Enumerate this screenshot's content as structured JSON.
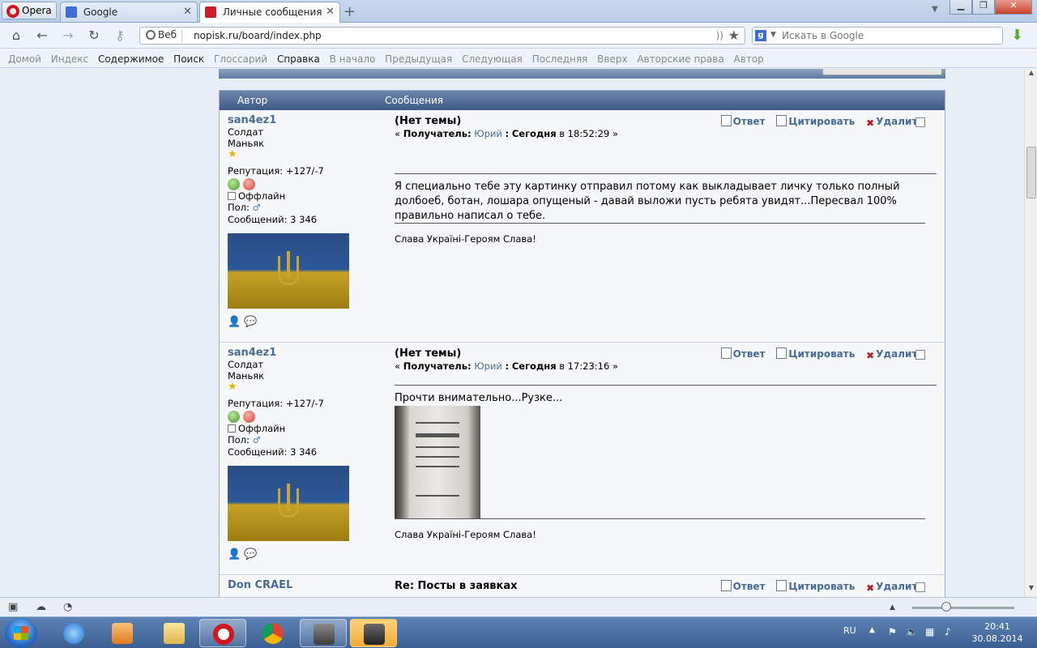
{
  "browser": {
    "opera_label": "Opera",
    "tabs": [
      {
        "label": "Google",
        "color": "#3b6fd4"
      },
      {
        "label": "Личные сообщения",
        "color": "#c8202b"
      }
    ],
    "new_tab_symbol": "+",
    "web_label": "Веб",
    "url": "nopisk.ru/board/index.php",
    "search_placeholder": "Искать в Google",
    "nav_links": [
      {
        "label": "Домой",
        "active": false
      },
      {
        "label": "Индекс",
        "active": false
      },
      {
        "label": "Содержимое",
        "active": true
      },
      {
        "label": "Поиск",
        "active": true
      },
      {
        "label": "Глоссарий",
        "active": false
      },
      {
        "label": "Справка",
        "active": true
      },
      {
        "label": "В начало",
        "active": false
      },
      {
        "label": "Предыдущая",
        "active": false
      },
      {
        "label": "Следующая",
        "active": false
      },
      {
        "label": "Последняя",
        "active": false
      },
      {
        "label": "Вверх",
        "active": false
      },
      {
        "label": "Авторские права",
        "active": false
      },
      {
        "label": "Автор",
        "active": false
      }
    ]
  },
  "board": {
    "header": {
      "author": "Автор",
      "messages": "Сообщения"
    },
    "actions": {
      "reply": "Ответ",
      "quote": "Цитировать",
      "delete": "Удалить"
    },
    "posts": [
      {
        "author": "san4ez1",
        "rank1": "Солдат",
        "rank2": "Маньяк",
        "reputation": "Репутация: +127/-7",
        "status": "Оффлайн",
        "gender": "Пол:",
        "messages_count": "Сообщений: 3 346",
        "title": "(Нет темы)",
        "meta_prefix": "«",
        "meta_label": "Получатель:",
        "recipient": "Юрий",
        "meta_sep": ":",
        "date_label": "Сегодня",
        "time_text": "в 18:52:29 »",
        "body": "Я специально тебе эту картинку отправил потому как выкладывает личку только полный долбоеб, ботан, лошара опущеный - давай выложи пусть ребята увидят...Пересвал 100% правильно написал о тебе.",
        "signature": "Слава Україні-Героям Слава!"
      },
      {
        "author": "san4ez1",
        "rank1": "Солдат",
        "rank2": "Маньяк",
        "reputation": "Репутация: +127/-7",
        "status": "Оффлайн",
        "gender": "Пол:",
        "messages_count": "Сообщений: 3 346",
        "title": "(Нет темы)",
        "meta_prefix": "«",
        "meta_label": "Получатель:",
        "recipient": "Юрий",
        "meta_sep": ":",
        "date_label": "Сегодня",
        "time_text": "в 17:23:16 »",
        "body": "Прочти внимательно...Рузке...",
        "signature": "Слава Україні-Героям Слава!"
      },
      {
        "author": "Don CRAEL",
        "title": "Re: Посты в заявках"
      }
    ]
  },
  "taskbar": {
    "lang": "RU",
    "time": "20:41",
    "date": "30.08.2014"
  }
}
